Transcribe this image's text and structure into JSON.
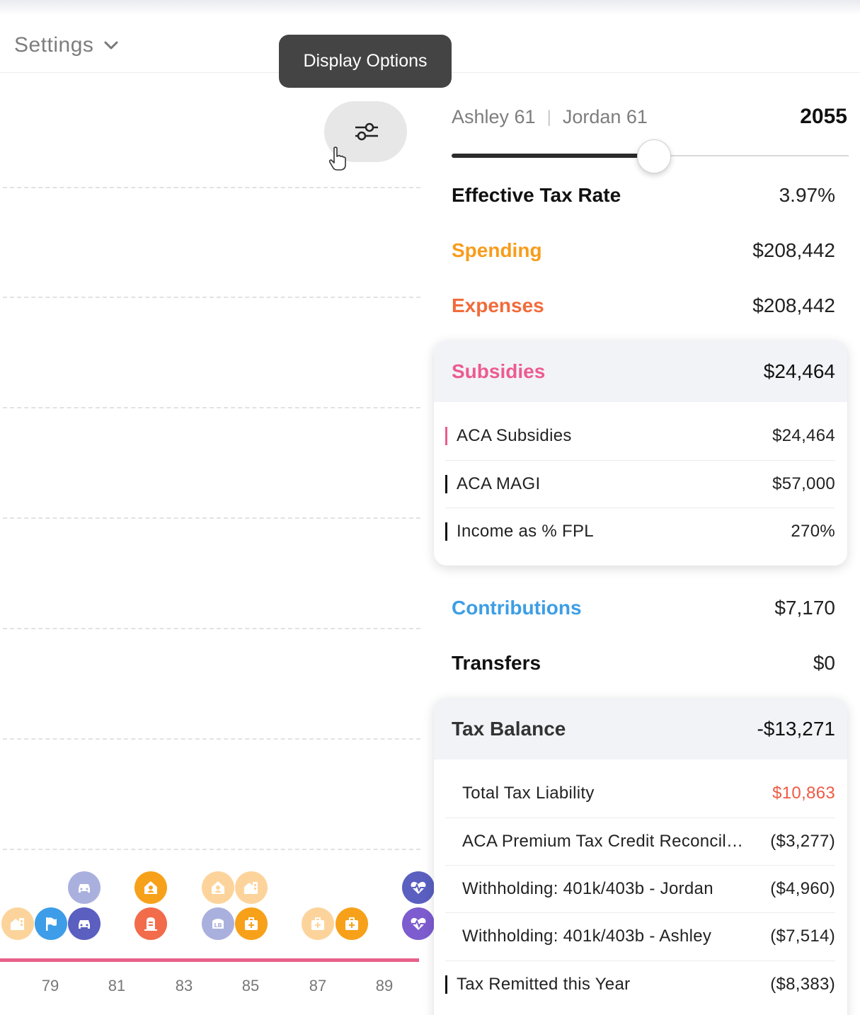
{
  "header": {
    "settings_label": "Settings",
    "tooltip": "Display Options"
  },
  "timeline": {
    "ticks": [
      "79",
      "81",
      "83",
      "85",
      "87",
      "89"
    ]
  },
  "panel": {
    "person1": "Ashley 61",
    "person2": "Jordan 61",
    "separator": "|",
    "year": "2055",
    "slider_fraction": 0.51,
    "rows": {
      "effective_tax_rate": {
        "label": "Effective Tax Rate",
        "value": "3.97%"
      },
      "spending": {
        "label": "Spending",
        "value": "$208,442",
        "color": "#f89c1c"
      },
      "expenses": {
        "label": "Expenses",
        "value": "$208,442",
        "color": "#f26b3a"
      },
      "contributions": {
        "label": "Contributions",
        "value": "$7,170",
        "color": "#3c9ee5"
      },
      "transfers": {
        "label": "Transfers",
        "value": "$0"
      }
    },
    "subsidies": {
      "label": "Subsidies",
      "value": "$24,464",
      "color": "#ec5b8f",
      "items": [
        {
          "label": "ACA Subsidies",
          "value": "$24,464",
          "bar_color": "#ec5b8f"
        },
        {
          "label": "ACA MAGI",
          "value": "$57,000",
          "bar_color": "#111111"
        },
        {
          "label": "Income as % FPL",
          "value": "270%",
          "bar_color": "#111111"
        }
      ]
    },
    "tax_balance": {
      "label": "Tax Balance",
      "value": "-$13,271",
      "items": [
        {
          "label": "Total Tax Liability",
          "value": "$10,863",
          "value_color": "#f05a44"
        },
        {
          "label": "ACA Premium Tax Credit Reconcil…",
          "value": "($3,277)"
        },
        {
          "label": "Withholding: 401k/403b - Jordan",
          "value": "($4,960)"
        },
        {
          "label": "Withholding: 401k/403b - Ashley",
          "value": "($7,514)"
        },
        {
          "label": "Tax Remitted this Year",
          "value": "($8,383)",
          "bar_color": "#111111"
        }
      ]
    }
  },
  "colors": {
    "pink_line": "#e8608a",
    "orange": "#f7a11a",
    "orange_light": "#fcd49b",
    "red_orange": "#f26b4a",
    "blue": "#3d9de8",
    "indigo": "#5a5fc0",
    "indigo_light": "#aab0de",
    "purple": "#7d5ccf"
  },
  "icons": {
    "settings_chevron": "chevron-down-icon",
    "options": "sliders-icon",
    "cursor": "hand-pointer-icon",
    "events": [
      "house-icon",
      "flag-icon",
      "car-icon",
      "home-person-icon",
      "gravestone-icon",
      "life-insurance-icon",
      "medical-bag-icon",
      "heart-pulse-icon"
    ]
  }
}
